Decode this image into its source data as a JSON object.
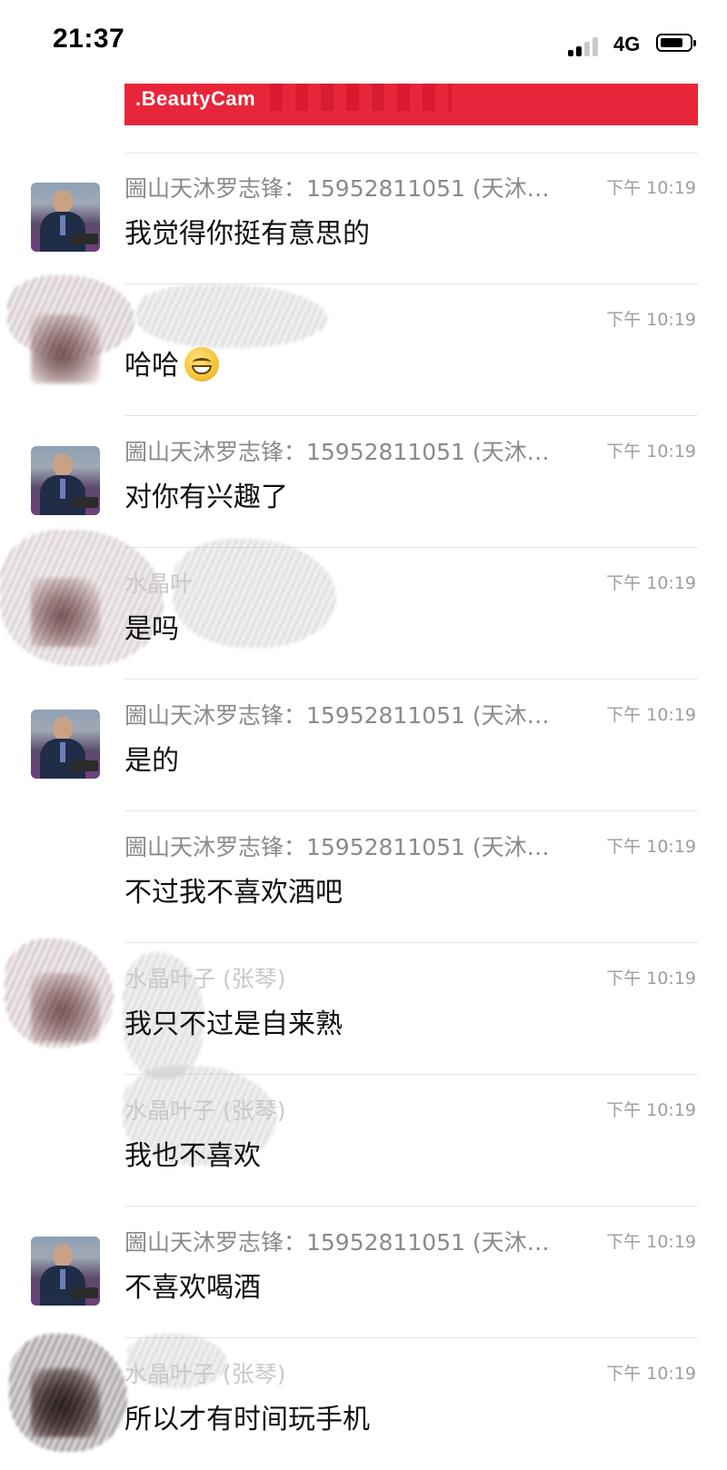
{
  "status_bar": {
    "time": "21:37",
    "network": "4G",
    "signal_bars_filled": 2,
    "signal_bars_total": 4
  },
  "banner": {
    "label": ".BeautyCam",
    "color": "#e8263a"
  },
  "messages": [
    {
      "avatar": "photo",
      "sender": "圌山天沐罗志锋：15952811051 (天沐…",
      "time": "下午 10:19",
      "text": "我觉得你挺有意思的"
    },
    {
      "avatar": "blurred",
      "sender": "",
      "time": "下午 10:19",
      "text": "哈哈",
      "emoji": "grinning-face"
    },
    {
      "avatar": "photo",
      "sender": "圌山天沐罗志锋：15952811051 (天沐…",
      "time": "下午 10:19",
      "text": "对你有兴趣了"
    },
    {
      "avatar": "blurred",
      "sender": "水晶叶",
      "time": "下午 10:19",
      "text": "是吗"
    },
    {
      "avatar": "photo",
      "sender": "圌山天沐罗志锋：15952811051 (天沐…",
      "time": "下午 10:19",
      "text": "是的"
    },
    {
      "avatar": "none",
      "sender": "圌山天沐罗志锋：15952811051 (天沐…",
      "time": "下午 10:19",
      "text": "不过我不喜欢酒吧"
    },
    {
      "avatar": "blurred",
      "sender": "水晶叶子 (张琴)",
      "time": "下午 10:19",
      "text": "我只不过是自来熟"
    },
    {
      "avatar": "none",
      "sender": "水晶叶子 (张琴)",
      "time": "下午 10:19",
      "text": "我也不喜欢"
    },
    {
      "avatar": "photo",
      "sender": "圌山天沐罗志锋：15952811051 (天沐…",
      "time": "下午 10:19",
      "text": "不喜欢喝酒"
    },
    {
      "avatar": "blurred-dark",
      "sender": "水晶叶子 (张琴)",
      "time": "下午 10:19",
      "text": "所以才有时间玩手机"
    }
  ]
}
